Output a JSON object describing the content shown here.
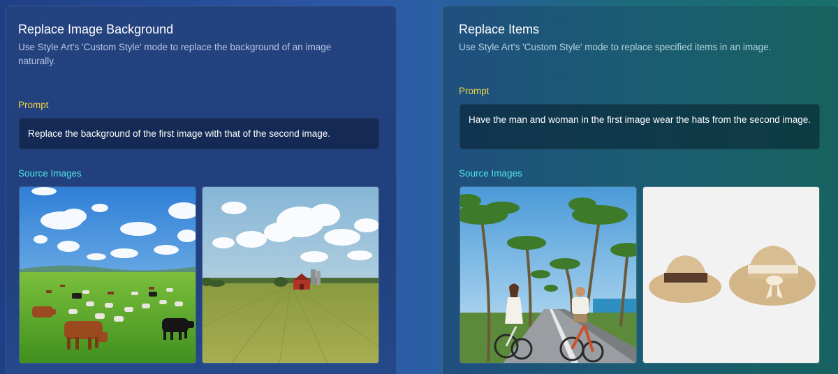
{
  "cards": [
    {
      "title": "Replace Image Background",
      "description": "Use Style Art's 'Custom Style' mode to replace the background of an image naturally.",
      "prompt_label": "Prompt",
      "prompt_text": "Replace the background of the first image with that of the second image.",
      "source_label": "Source Images",
      "images": [
        {
          "subject": "cows-and-sheep-grazing-pasture"
        },
        {
          "subject": "farm-field-with-red-barn"
        }
      ]
    },
    {
      "title": "Replace Items",
      "description": "Use Style Art's 'Custom Style' mode to replace specified items in an image.",
      "prompt_label": "Prompt",
      "prompt_text": "Have the man and woman in the first image wear the hats from the second image.",
      "source_label": "Source Images",
      "images": [
        {
          "subject": "couple-cycling-palm-road"
        },
        {
          "subject": "two-straw-hats"
        }
      ]
    }
  ],
  "colors": {
    "prompt_label": "#f0d24a",
    "source_label": "#4fe3e8"
  }
}
